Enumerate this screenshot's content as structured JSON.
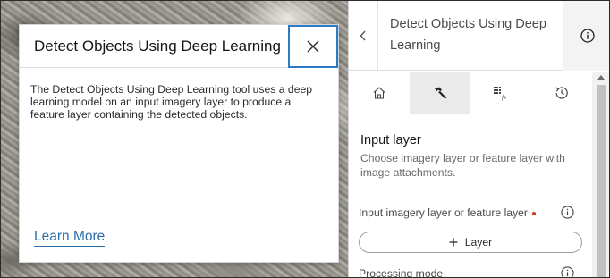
{
  "popup": {
    "title": "Detect Objects Using Deep Learning",
    "body": "The Detect Objects Using Deep Learning tool uses a deep learning model on an input imagery layer to produce a feature layer containing the detected objects.",
    "link": "Learn More"
  },
  "panel": {
    "title": "Detect Objects Using Deep Learning",
    "tabs": [
      {
        "icon": "home-icon"
      },
      {
        "icon": "hammer-icon"
      },
      {
        "icon": "raster-function-icon"
      },
      {
        "icon": "history-icon"
      }
    ],
    "section": {
      "title": "Input layer",
      "description": "Choose imagery layer or feature layer with image attachments."
    },
    "input_field": {
      "label": "Input imagery layer or feature layer",
      "button_label": "Layer"
    },
    "processing_field": {
      "label": "Processing mode"
    }
  },
  "colors": {
    "accent": "#2c7cc5",
    "link": "#2c6fa8",
    "required": "#d83020"
  }
}
